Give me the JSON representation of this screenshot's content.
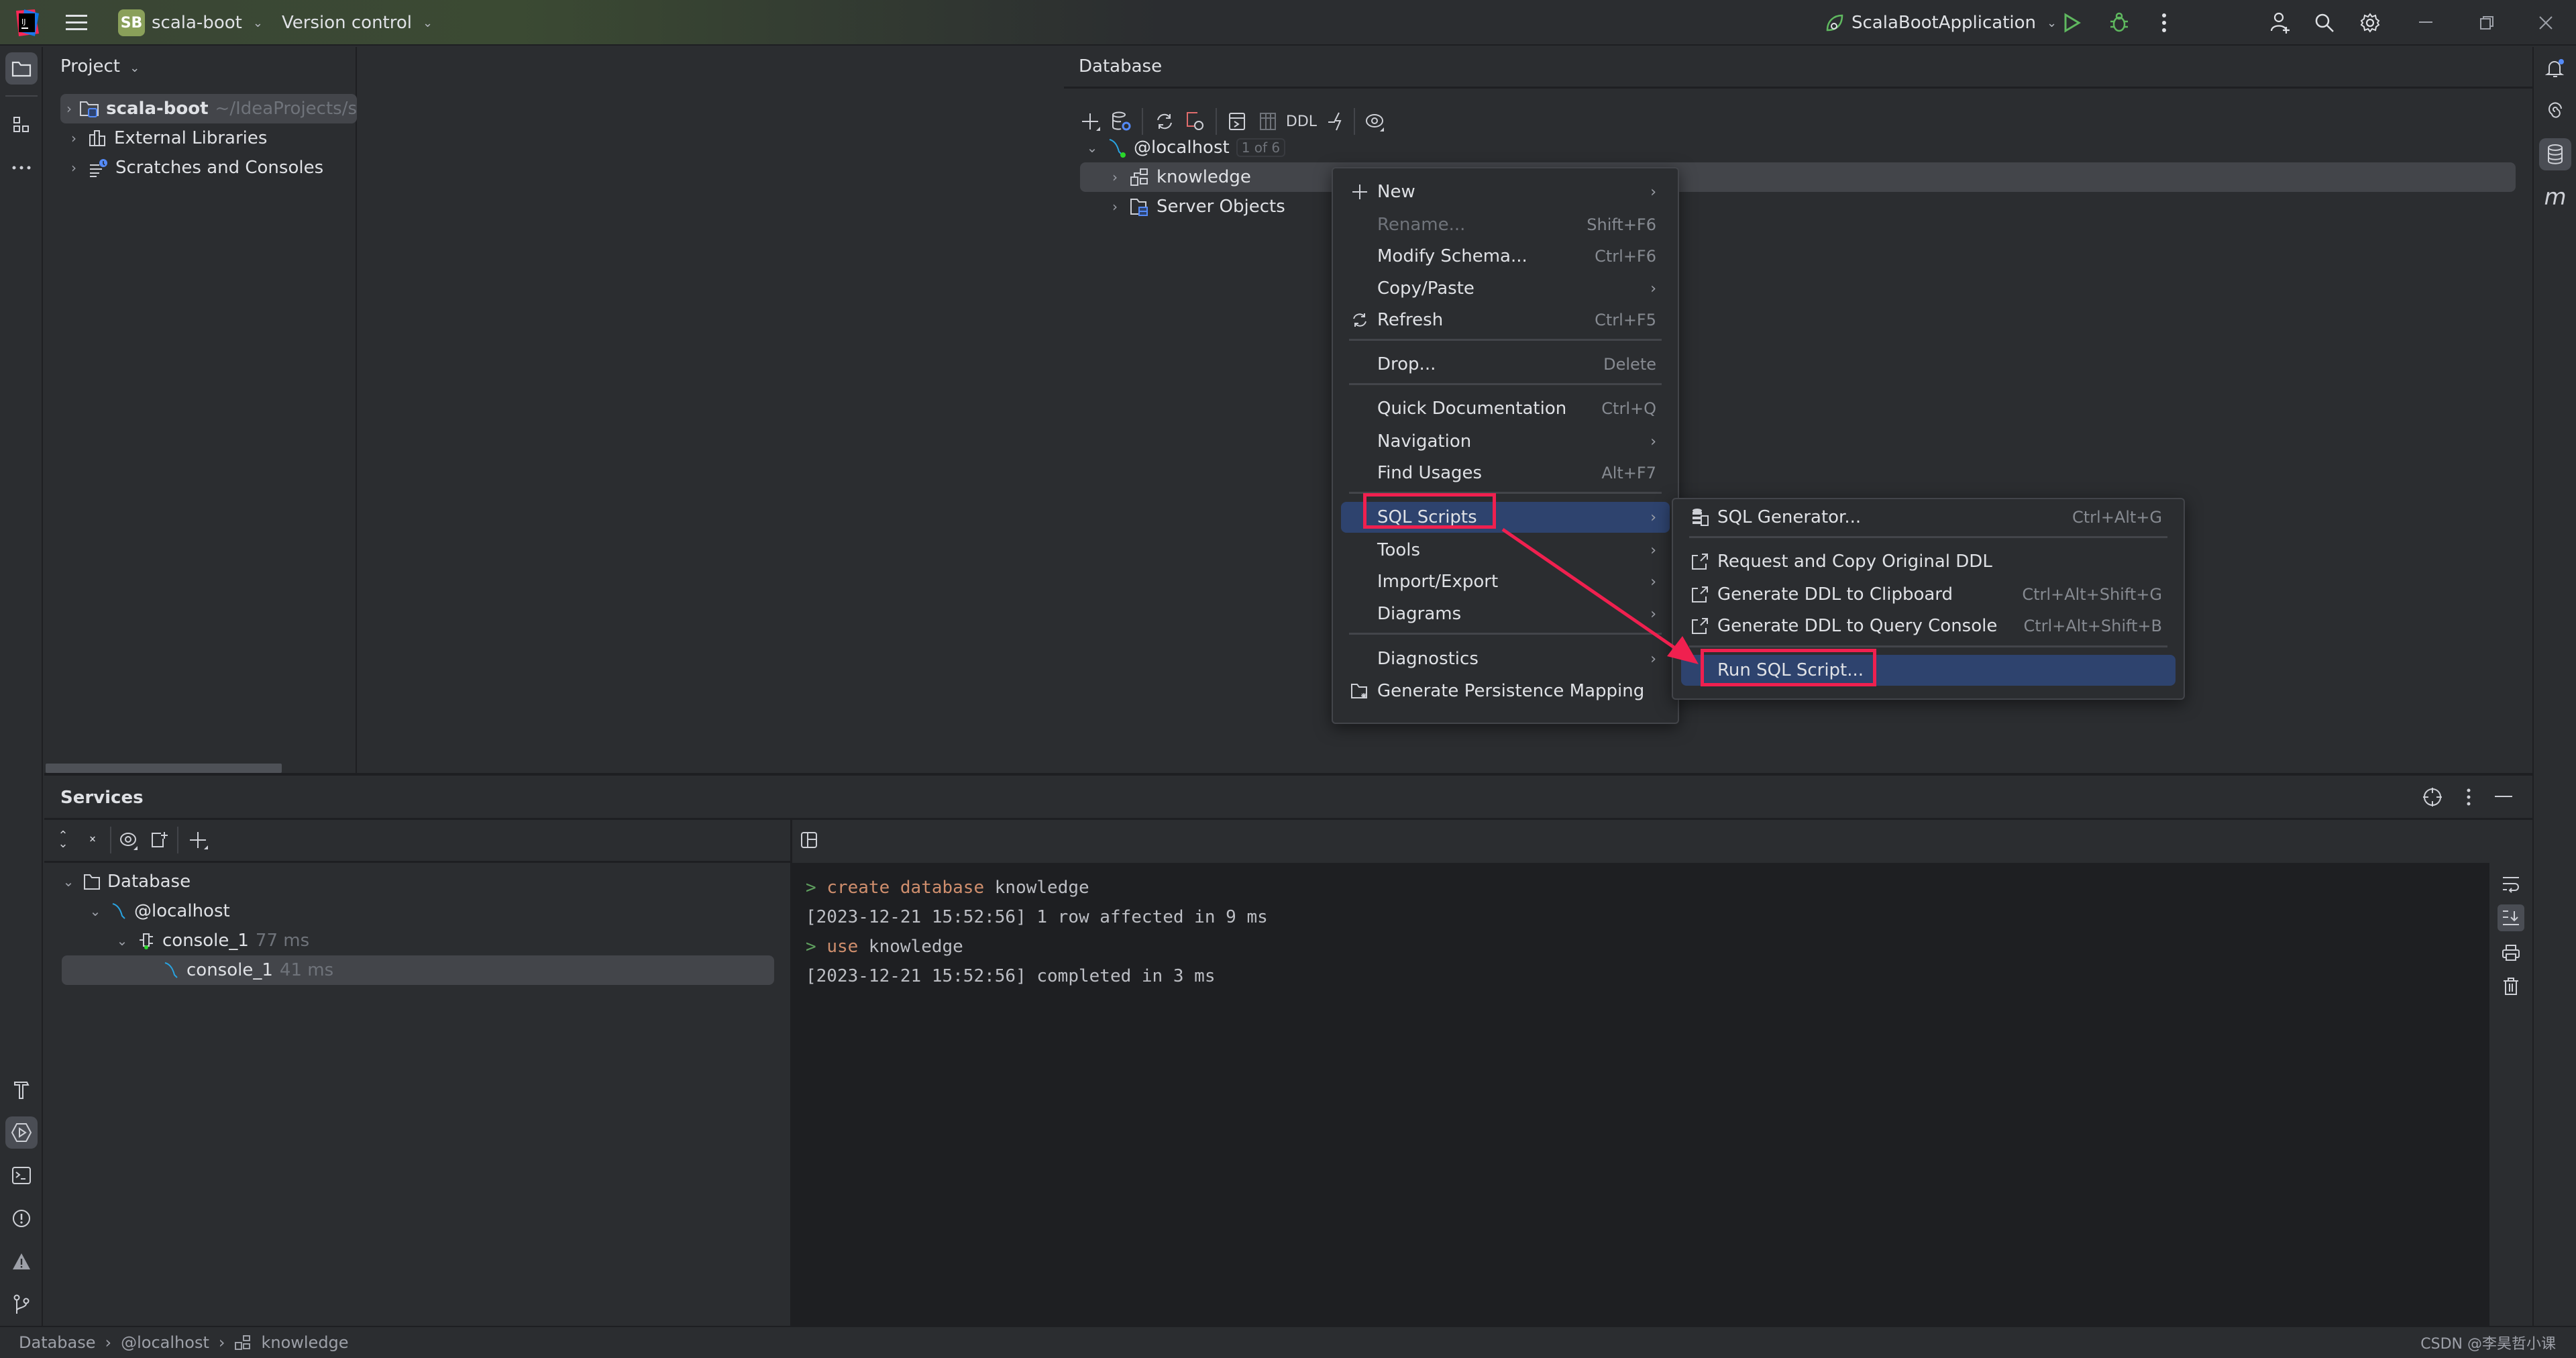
{
  "titlebar": {
    "project_badge": "SB",
    "project_name": "scala-boot",
    "vcs_label": "Version control",
    "run_config": "ScalaBootApplication"
  },
  "project_panel": {
    "title": "Project",
    "items": [
      {
        "label": "scala-boot",
        "hint": "~/IdeaProjects/s",
        "icon": "module-folder-icon",
        "selected": true
      },
      {
        "label": "External Libraries",
        "icon": "libraries-icon"
      },
      {
        "label": "Scratches and Consoles",
        "icon": "scratches-icon"
      }
    ]
  },
  "database_panel": {
    "title": "Database",
    "toolbar": {
      "ddl_label": "DDL"
    },
    "tree": {
      "host": {
        "label": "@localhost",
        "badge": "1 of 6"
      },
      "children": [
        {
          "label": "knowledge",
          "icon": "schema-icon",
          "selected": true
        },
        {
          "label": "Server Objects",
          "icon": "server-objects-icon"
        }
      ]
    }
  },
  "context_menu": {
    "items": [
      {
        "label": "New",
        "submenu": true,
        "icon": "plus-icon"
      },
      {
        "label": "Rename...",
        "shortcut": "Shift+F6",
        "disabled": true
      },
      {
        "label": "Modify Schema...",
        "shortcut": "Ctrl+F6"
      },
      {
        "label": "Copy/Paste",
        "submenu": true
      },
      {
        "label": "Refresh",
        "shortcut": "Ctrl+F5",
        "icon": "refresh-icon"
      },
      {
        "label": "Drop...",
        "shortcut": "Delete"
      },
      {
        "label": "Quick Documentation",
        "shortcut": "Ctrl+Q"
      },
      {
        "label": "Navigation",
        "submenu": true
      },
      {
        "label": "Find Usages",
        "shortcut": "Alt+F7"
      },
      {
        "label": "SQL Scripts",
        "submenu": true,
        "highlighted": true
      },
      {
        "label": "Tools",
        "submenu": true
      },
      {
        "label": "Import/Export",
        "submenu": true
      },
      {
        "label": "Diagrams",
        "submenu": true
      },
      {
        "label": "Diagnostics",
        "submenu": true
      },
      {
        "label": "Generate Persistence Mapping",
        "icon": "persistence-icon"
      }
    ]
  },
  "sql_scripts_submenu": {
    "items": [
      {
        "label": "SQL Generator...",
        "shortcut": "Ctrl+Alt+G",
        "icon": "sql-generator-icon"
      },
      {
        "label": "Request and Copy Original DDL",
        "icon": "external-link-icon"
      },
      {
        "label": "Generate DDL to Clipboard",
        "shortcut": "Ctrl+Alt+Shift+G",
        "icon": "external-link-icon"
      },
      {
        "label": "Generate DDL to Query Console",
        "shortcut": "Ctrl+Alt+Shift+B",
        "icon": "external-link-icon"
      },
      {
        "label": "Run SQL Script...",
        "highlighted": true
      }
    ]
  },
  "services_panel": {
    "title": "Services",
    "tree": [
      {
        "label": "Database",
        "level": 0
      },
      {
        "label": "@localhost",
        "level": 1
      },
      {
        "label": "console_1",
        "time": "77 ms",
        "level": 2
      },
      {
        "label": "console_1",
        "time": "41 ms",
        "level": 3,
        "selected": true
      }
    ],
    "console_lines": [
      {
        "type": "cmd",
        "keyword": "create database",
        "rest": " knowledge"
      },
      {
        "type": "out",
        "text": "[2023-12-21 15:52:56] 1 row affected in 9 ms"
      },
      {
        "type": "cmd",
        "keyword": "use",
        "rest": " knowledge"
      },
      {
        "type": "out",
        "text": "[2023-12-21 15:52:56] completed in 3 ms"
      }
    ]
  },
  "statusbar": {
    "breadcrumbs": [
      "Database",
      "@localhost",
      "knowledge"
    ],
    "watermark": "CSDN @李昊哲小课"
  },
  "colors": {
    "accent_highlight": "#2e436e",
    "annotation_red": "#f0204f",
    "keyword": "#cf8e6d",
    "prompt": "#5fa05f"
  }
}
